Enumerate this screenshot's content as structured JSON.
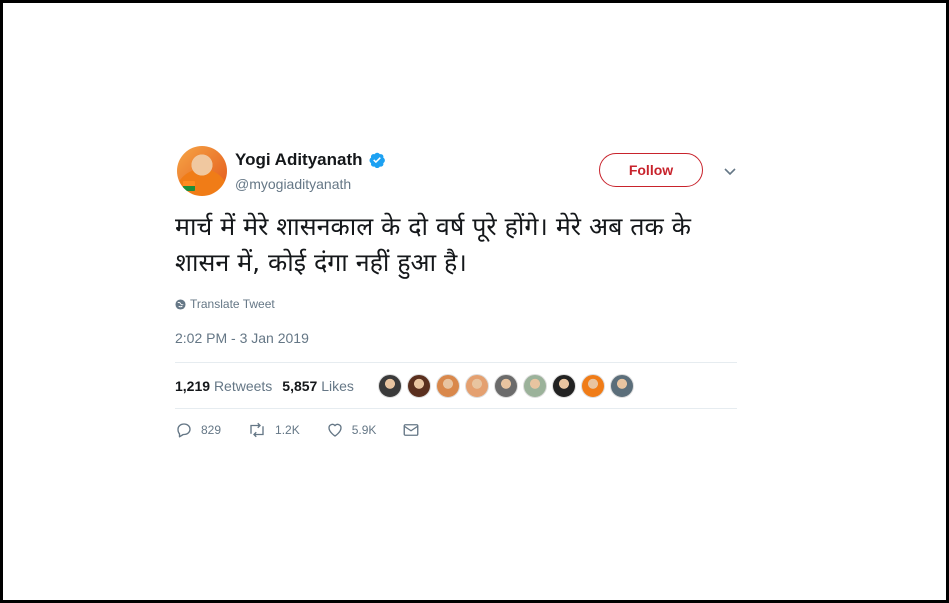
{
  "tweet": {
    "display_name": "Yogi Adityanath",
    "handle": "@myogiadityanath",
    "verified_icon": "verified-badge-icon",
    "follow_label": "Follow",
    "text": "मार्च में मेरे शासनकाल के दो वर्ष पूरे होंगे। मेरे अब तक के शासन में, कोई दंगा नहीं हुआ है।",
    "translate_label": "Translate Tweet",
    "timestamp": "2:02 PM - 3 Jan 2019",
    "retweets_count": "1,219",
    "retweets_label": "Retweets",
    "likes_count": "5,857",
    "likes_label": "Likes",
    "reply_count": "829",
    "retweet_action_count": "1.2K",
    "like_action_count": "5.9K"
  },
  "colors": {
    "follow_accent": "#c8232c",
    "verified_blue": "#1da1f2",
    "muted_text": "#657786",
    "frame_border": "#000000"
  },
  "liker_avatars": [
    {
      "name": "liker-avatar-1",
      "color": "#3a3a3a"
    },
    {
      "name": "liker-avatar-2",
      "color": "#5a2f1e"
    },
    {
      "name": "liker-avatar-3",
      "color": "#d9884b"
    },
    {
      "name": "liker-avatar-4",
      "color": "#e4a070"
    },
    {
      "name": "liker-avatar-5",
      "color": "#6b6b6b"
    },
    {
      "name": "liker-avatar-6",
      "color": "#9bb29a"
    },
    {
      "name": "liker-avatar-7",
      "color": "#222222"
    },
    {
      "name": "liker-avatar-8",
      "color": "#f07c17"
    },
    {
      "name": "liker-avatar-9",
      "color": "#5b6e7a"
    }
  ]
}
